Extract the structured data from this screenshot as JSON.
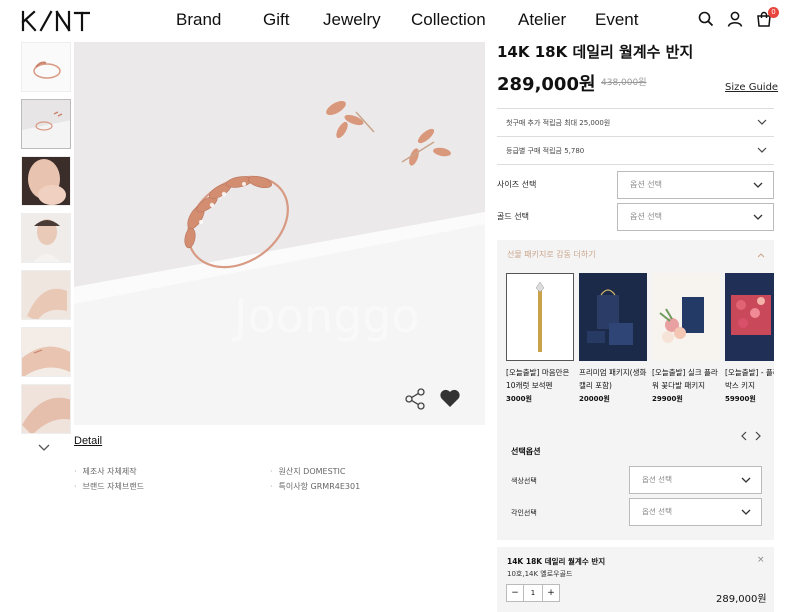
{
  "brand": {
    "logo_alt": "K/NT"
  },
  "nav": {
    "items": [
      "Brand",
      "Gift",
      "Jewelry",
      "Collection",
      "Atelier",
      "Event"
    ]
  },
  "header": {
    "cart_count": "0"
  },
  "product": {
    "title": "14K 18K 데일리 월계수 반지",
    "price": "289,000원",
    "original_price": "438,000원",
    "size_guide": "Size Guide"
  },
  "benefits": [
    "첫구매 추가 적립금 최대 25,000원",
    "등급별 구매 적립금 5,780"
  ],
  "options": {
    "size_label": "사이즈 선택",
    "gold_label": "골드 선택",
    "placeholder": "옵션 선택"
  },
  "gift": {
    "heading": "선물 패키지로 감동 더하기",
    "items": [
      {
        "name": "[오늘출발] 마음만은 10캐럿 보석펜",
        "price": "3000원"
      },
      {
        "name": "프리미엄 패키지(생화 캘리 포함)",
        "price": "20000원"
      },
      {
        "name": "[오늘출발] 실크 플라워 꽃다발 패키지",
        "price": "29900원"
      },
      {
        "name": "[오늘출발] - 플라워 박스 키지",
        "price": "59900원"
      }
    ],
    "option_title": "선택옵션",
    "color_label": "색상선택",
    "engrave_label": "각인선택",
    "placeholder": "옵션 선택"
  },
  "detail": {
    "link": "Detail",
    "specs": [
      "제조사 자체제작",
      "원산지 DOMESTIC",
      "브랜드 자체브랜드",
      "특이사항 GRMR4E301"
    ]
  },
  "cart": {
    "name": "14K 18K 데일리 월계수 반지",
    "sub": "10호,14K 옐로우골드",
    "qty": "1",
    "minus": "−",
    "plus": "+",
    "close": "×",
    "total": "289,000원"
  },
  "colors": {
    "accent_text": "#caa58c",
    "badge": "#e8453c",
    "rose_gold": "#d89a83"
  }
}
